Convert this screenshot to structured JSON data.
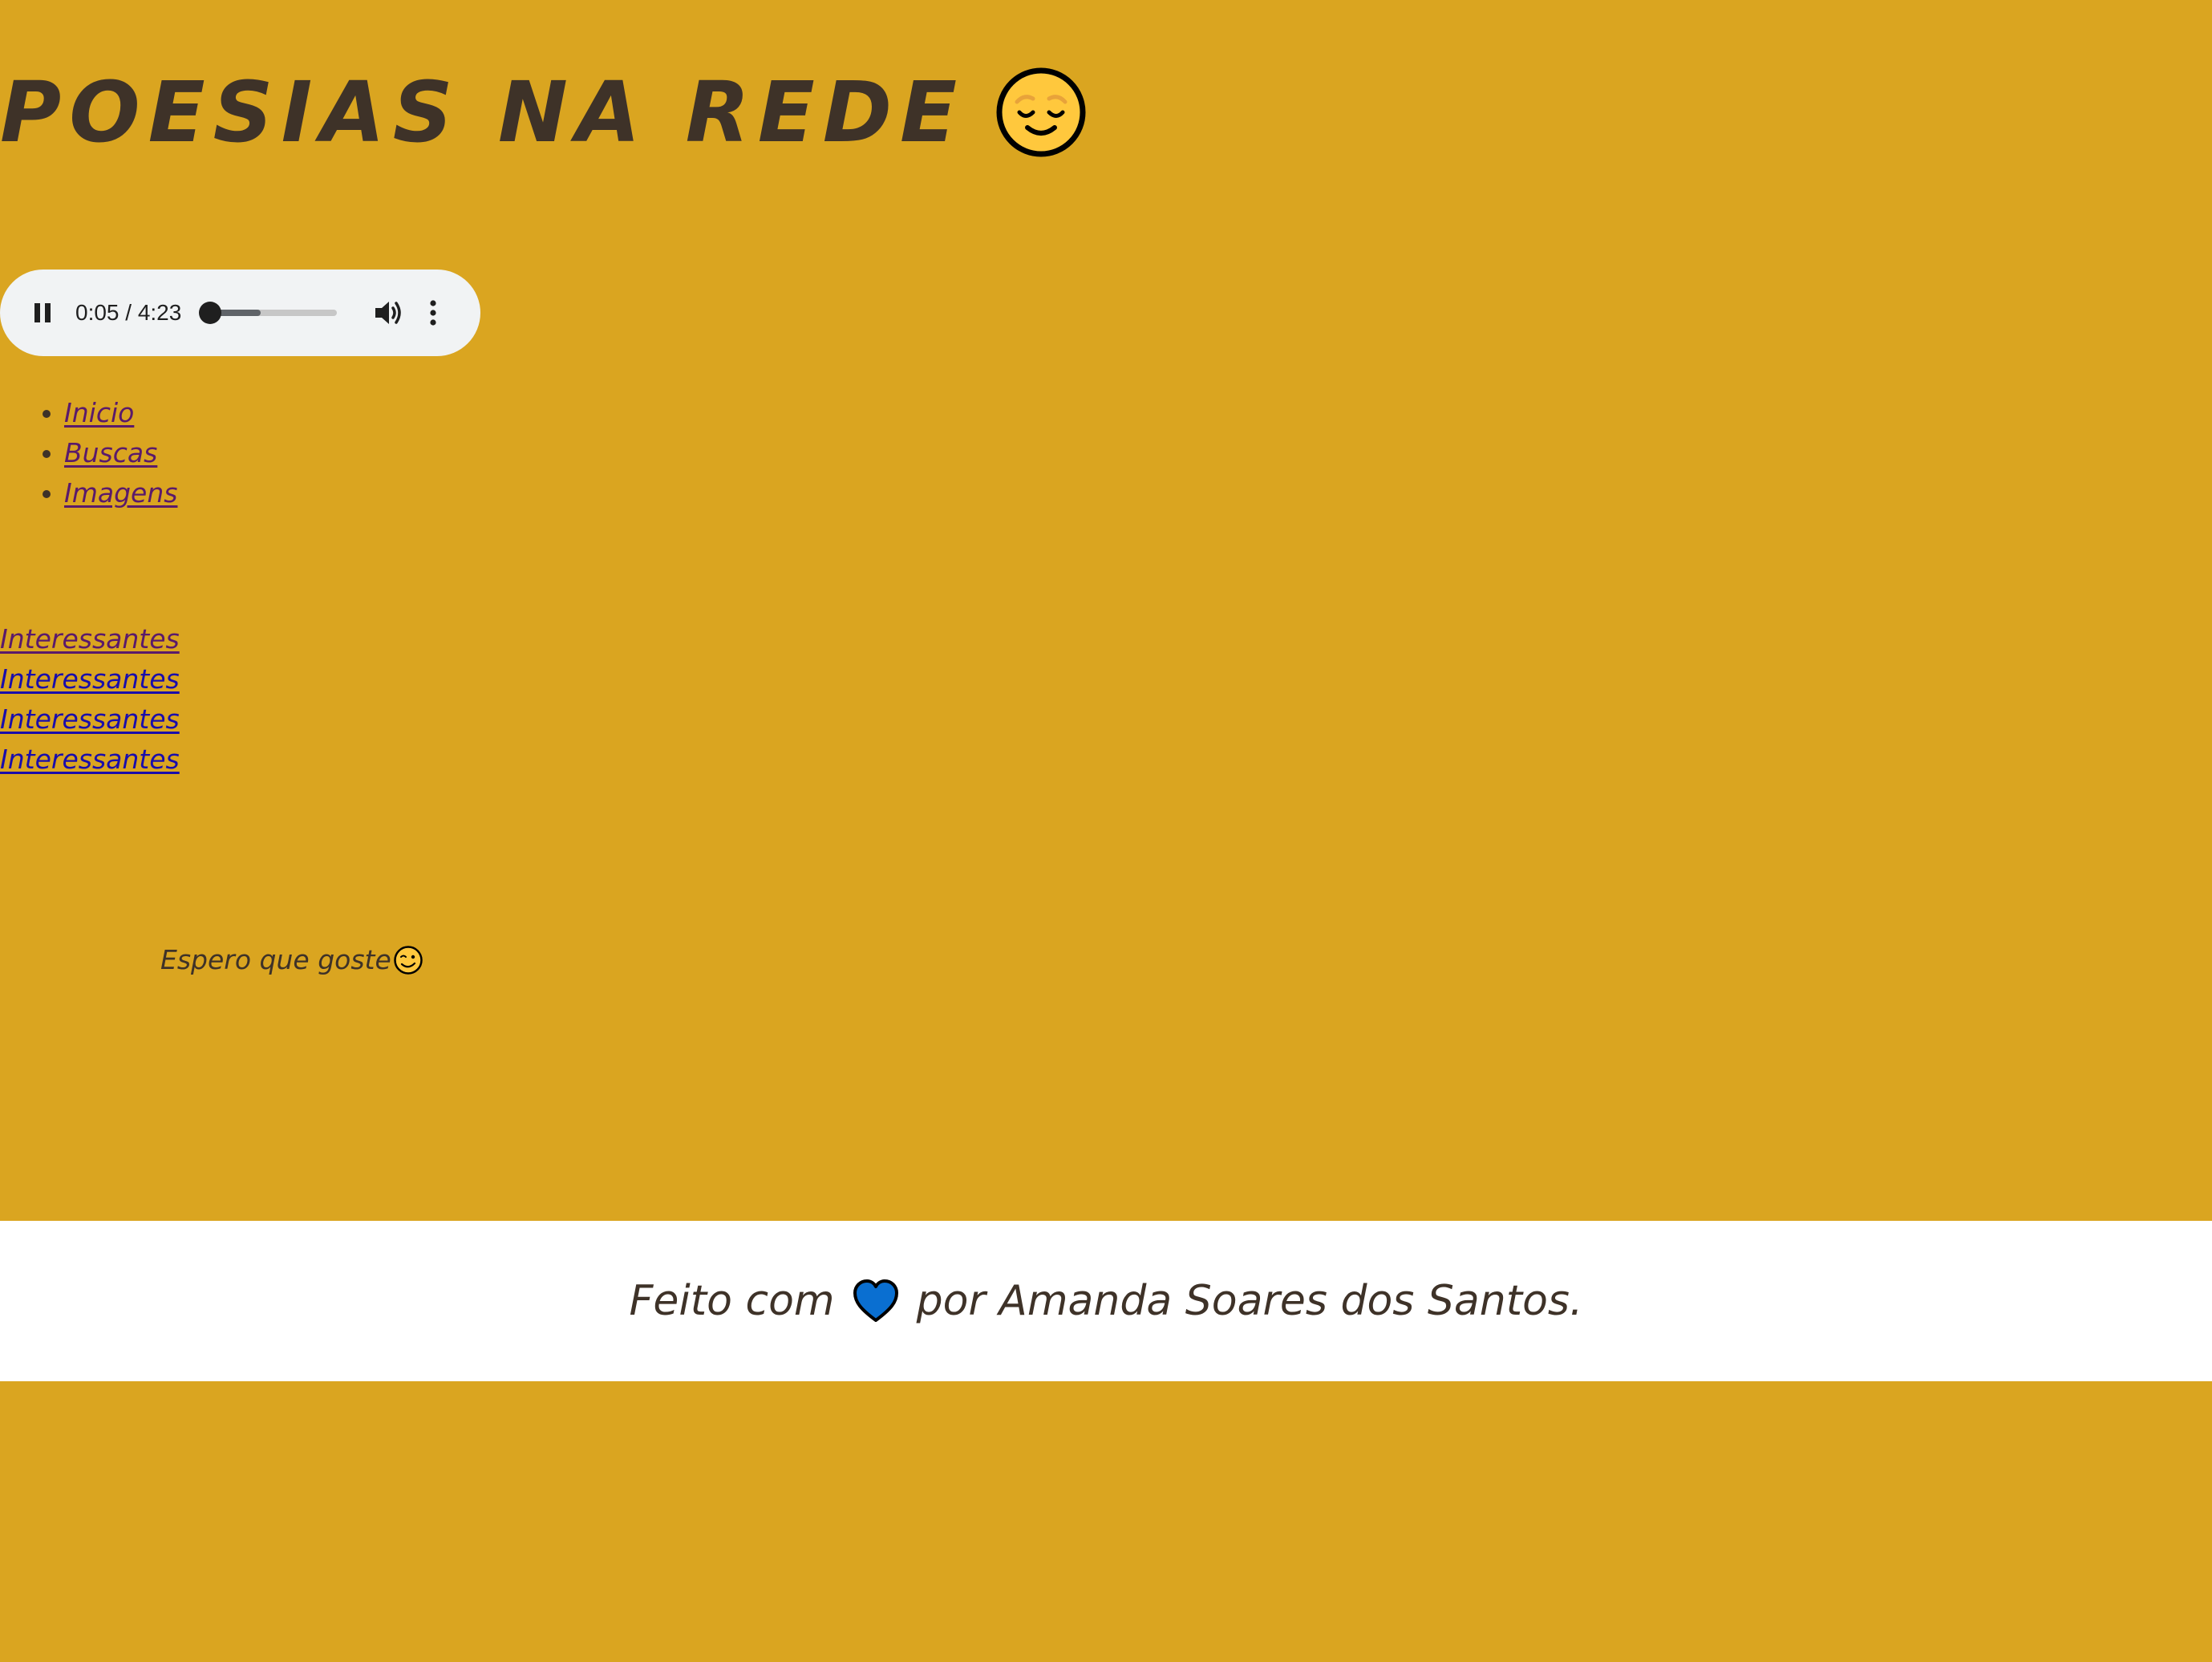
{
  "header": {
    "title": "POESIAS NA REDE",
    "title_emoji": "relieved-face-icon"
  },
  "audio": {
    "time": "0:05 / 4:23",
    "state": "playing",
    "progress_fraction": 0.02,
    "buffered_fraction": 0.41
  },
  "nav": {
    "items": [
      {
        "label": "Inicio"
      },
      {
        "label": "Buscas"
      },
      {
        "label": "Imagens"
      }
    ]
  },
  "links": [
    {
      "label": "Interessantes",
      "visited": true
    },
    {
      "label": "Interessantes",
      "visited": false
    },
    {
      "label": "Interessantes",
      "visited": false
    },
    {
      "label": "Interessantes",
      "visited": false
    }
  ],
  "greeting": {
    "text": "Espero que goste",
    "emoji": "winking-face-icon"
  },
  "footer": {
    "before": "Feito com",
    "heart": "blue-heart-icon",
    "after": "por Amanda Soares dos Santos."
  },
  "colors": {
    "background": "#daa520",
    "text": "#3e3228",
    "visited_link": "#5a1a6b",
    "link": "#1a0dab",
    "footer_bg": "#ffffff",
    "heart": "#0a6fd1"
  }
}
